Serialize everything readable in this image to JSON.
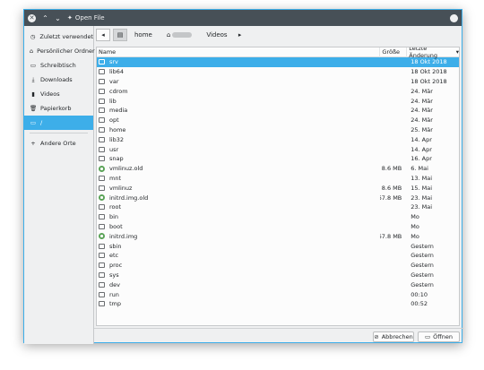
{
  "window": {
    "title": "Open File",
    "pin_icon": "pin-icon"
  },
  "sidebar": {
    "items": [
      {
        "label": "Zuletzt verwendet",
        "icon": "clock-icon",
        "glyph": "◷"
      },
      {
        "label": "Persönlicher Ordner",
        "icon": "home-icon",
        "glyph": "⌂"
      },
      {
        "label": "Schreibtisch",
        "icon": "desktop-icon",
        "glyph": "▭"
      },
      {
        "label": "Downloads",
        "icon": "download-icon",
        "glyph": "⤓"
      },
      {
        "label": "Videos",
        "icon": "video-icon",
        "glyph": "▮"
      },
      {
        "label": "Papierkorb",
        "icon": "trash-icon",
        "glyph": "🗑"
      },
      {
        "label": "/",
        "icon": "drive-icon",
        "glyph": "▭",
        "active": true
      }
    ],
    "other_locations": {
      "label": "Andere Orte",
      "icon": "plus-icon",
      "glyph": "+"
    }
  },
  "pathbar": {
    "back_glyph": "◂",
    "drive_glyph": "▤",
    "crumbs": [
      "home",
      "Videos"
    ],
    "forward_glyph": "▸"
  },
  "columns": {
    "name": "Name",
    "size": "Größe",
    "date": "Letzte Änderung",
    "sort_indicator": "▾"
  },
  "files": [
    {
      "name": "srv",
      "size": "",
      "date": "18 Okt 2018",
      "kind": "folder",
      "selected": true
    },
    {
      "name": "lib64",
      "size": "",
      "date": "18 Okt 2018",
      "kind": "folder"
    },
    {
      "name": "var",
      "size": "",
      "date": "18 Okt 2018",
      "kind": "folder"
    },
    {
      "name": "cdrom",
      "size": "",
      "date": "24. Mär",
      "kind": "folder"
    },
    {
      "name": "lib",
      "size": "",
      "date": "24. Mär",
      "kind": "folder"
    },
    {
      "name": "media",
      "size": "",
      "date": "24. Mär",
      "kind": "folder"
    },
    {
      "name": "opt",
      "size": "",
      "date": "24. Mär",
      "kind": "folder"
    },
    {
      "name": "home",
      "size": "",
      "date": "25. Mär",
      "kind": "folder"
    },
    {
      "name": "lib32",
      "size": "",
      "date": "14. Apr",
      "kind": "folder"
    },
    {
      "name": "usr",
      "size": "",
      "date": "14. Apr",
      "kind": "folder"
    },
    {
      "name": "snap",
      "size": "",
      "date": "16. Apr",
      "kind": "folder"
    },
    {
      "name": "vmlinuz.old",
      "size": "8.6 MB",
      "date": "6. Mai",
      "kind": "exec"
    },
    {
      "name": "mnt",
      "size": "",
      "date": "13. Mai",
      "kind": "folder"
    },
    {
      "name": "vmlinuz",
      "size": "8.6 MB",
      "date": "15. Mai",
      "kind": "folder"
    },
    {
      "name": "initrd.img.old",
      "size": "67.8 MB",
      "date": "23. Mai",
      "kind": "exec"
    },
    {
      "name": "root",
      "size": "",
      "date": "23. Mai",
      "kind": "folder"
    },
    {
      "name": "bin",
      "size": "",
      "date": "Mo",
      "kind": "folder"
    },
    {
      "name": "boot",
      "size": "",
      "date": "Mo",
      "kind": "folder"
    },
    {
      "name": "initrd.img",
      "size": "67.8 MB",
      "date": "Mo",
      "kind": "exec"
    },
    {
      "name": "sbin",
      "size": "",
      "date": "Gestern",
      "kind": "folder"
    },
    {
      "name": "etc",
      "size": "",
      "date": "Gestern",
      "kind": "folder"
    },
    {
      "name": "proc",
      "size": "",
      "date": "Gestern",
      "kind": "folder"
    },
    {
      "name": "sys",
      "size": "",
      "date": "Gestern",
      "kind": "folder"
    },
    {
      "name": "dev",
      "size": "",
      "date": "Gestern",
      "kind": "folder"
    },
    {
      "name": "run",
      "size": "",
      "date": "00:10",
      "kind": "folder"
    },
    {
      "name": "tmp",
      "size": "",
      "date": "00:52",
      "kind": "folder"
    }
  ],
  "buttons": {
    "cancel": {
      "label": "Abbrechen",
      "icon": "cancel-icon",
      "glyph": "⊘"
    },
    "open": {
      "label": "Öffnen",
      "icon": "folder-open-icon",
      "glyph": "▭"
    }
  },
  "colors": {
    "accent": "#3daee9",
    "titlebar": "#475057",
    "window_bg": "#eff0f1",
    "list_bg": "#fcfcfc"
  }
}
